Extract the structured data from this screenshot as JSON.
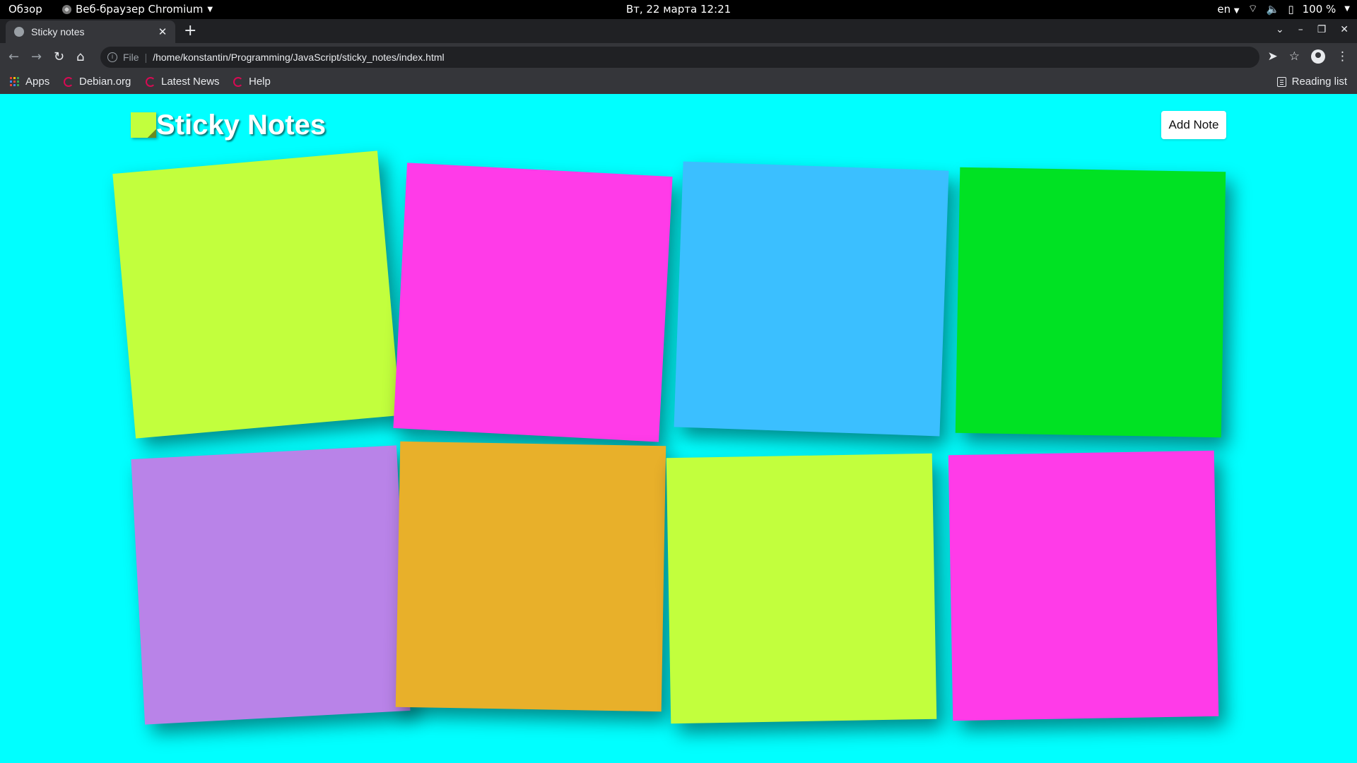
{
  "system_bar": {
    "activities": "Обзор",
    "app_menu": "Веб-браузер Chromium",
    "clock": "Вт, 22 марта  12:21",
    "language": "en",
    "battery": "100 %"
  },
  "browser": {
    "tab_title": "Sticky notes",
    "omnibox_scheme": "File",
    "url": "/home/konstantin/Programming/JavaScript/sticky_notes/index.html",
    "bookmarks": [
      "Apps",
      "Debian.org",
      "Latest News",
      "Help"
    ],
    "reading_list": "Reading list"
  },
  "page": {
    "title": "Sticky Notes",
    "add_note_label": "Add Note",
    "background_color": "#00ffff",
    "logo_color": "#c2ff3d"
  },
  "notes": [
    {
      "color": "#c2ff3d",
      "text": ""
    },
    {
      "color": "#ff3be8",
      "text": ""
    },
    {
      "color": "#3bbfff",
      "text": ""
    },
    {
      "color": "#00e223",
      "text": ""
    },
    {
      "color": "#b983e8",
      "text": ""
    },
    {
      "color": "#e8b02a",
      "text": ""
    },
    {
      "color": "#c2ff3d",
      "text": ""
    },
    {
      "color": "#ff3be8",
      "text": ""
    }
  ]
}
